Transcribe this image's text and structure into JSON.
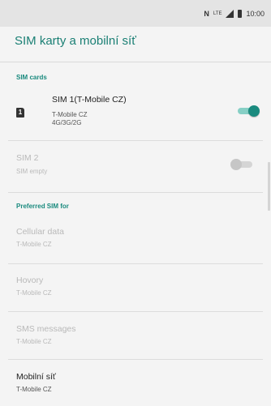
{
  "status_bar": {
    "nfc": "N",
    "network": "LTE",
    "time": "10:00"
  },
  "header": {
    "title": "SIM karty a mobilní síť"
  },
  "sections": {
    "sim_cards": "SIM cards",
    "preferred_sim": "Preferred SIM for"
  },
  "sim1": {
    "icon_label": "1",
    "title": "SIM 1(T-Mobile CZ)",
    "line1": "T-Mobile CZ",
    "line2": "4G/3G/2G",
    "enabled": true
  },
  "sim2": {
    "title": "SIM 2",
    "subtitle": "SIM empty",
    "enabled": false
  },
  "preferred": [
    {
      "title": "Cellular data",
      "subtitle": "T-Mobile CZ"
    },
    {
      "title": "Hovory",
      "subtitle": "T-Mobile CZ"
    },
    {
      "title": "SMS messages",
      "subtitle": "T-Mobile CZ"
    }
  ],
  "mobile_network": {
    "title": "Mobilní síť",
    "subtitle": "T-Mobile CZ"
  },
  "colors": {
    "accent": "#1a8a7e",
    "title": "#1a7f74",
    "disabled_text": "#b9b9b9"
  },
  "icons": {
    "sim": "sim-card-icon",
    "signal": "signal-icon",
    "battery": "battery-icon",
    "nfc": "nfc-icon"
  }
}
